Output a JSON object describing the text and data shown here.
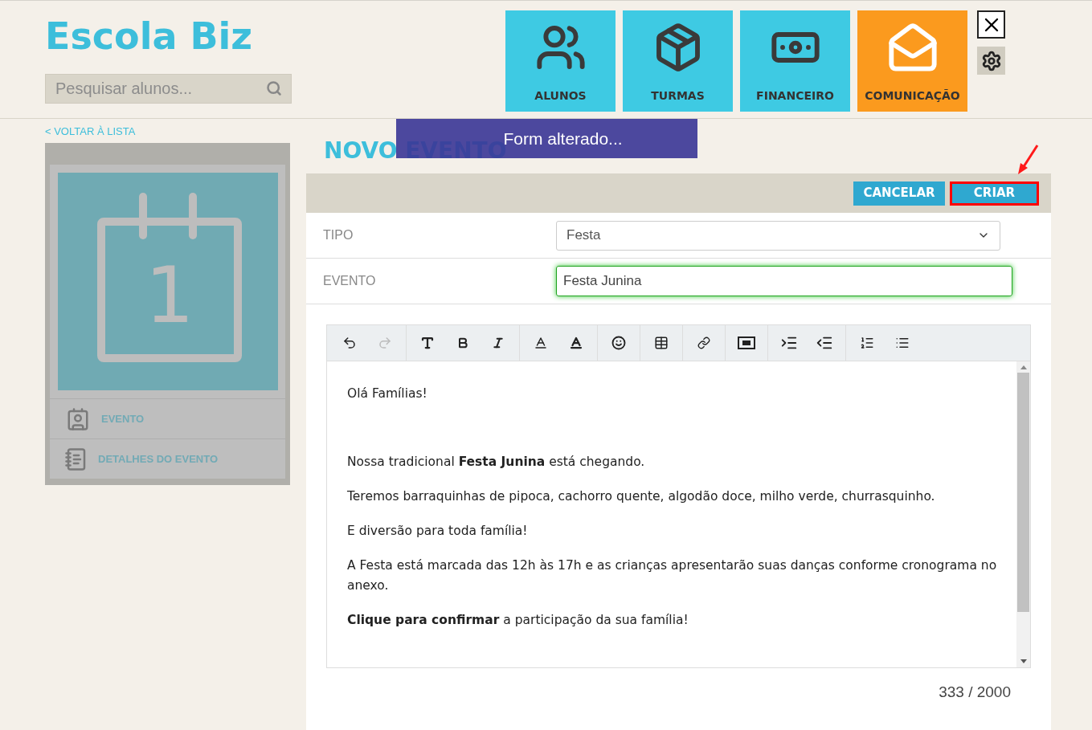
{
  "header": {
    "logo": "Escola Biz",
    "search": {
      "placeholder": "Pesquisar alunos..."
    },
    "nav": [
      {
        "label": "ALUNOS",
        "kind": "users",
        "selected": false
      },
      {
        "label": "TURMAS",
        "kind": "box",
        "selected": false
      },
      {
        "label": "FINANCEIRO",
        "kind": "money",
        "selected": false
      },
      {
        "label": "COMUNICAÇÃO",
        "kind": "mail",
        "selected": true
      }
    ]
  },
  "back_link": "< VOLTAR À LISTA",
  "sidebar": {
    "day": "1",
    "items": [
      {
        "label": "EVENTO",
        "kind": "contact"
      },
      {
        "label": "DETALHES DO EVENTO",
        "kind": "notebook"
      }
    ]
  },
  "heading": "NOVO EVENTO",
  "toast": "Form alterado...",
  "actions": [
    {
      "label": "CANCELAR",
      "highlighted": false
    },
    {
      "label": "CRIAR",
      "highlighted": true
    }
  ],
  "fields": [
    {
      "label": "TIPO",
      "kind": "select",
      "value": "Festa",
      "valid": false
    },
    {
      "label": "EVENTO",
      "kind": "text",
      "value": "Festa Junina",
      "valid": true
    }
  ],
  "editor": {
    "paragraphs": [
      "Olá Famílias!",
      "Nossa tradicional **Festa Junina** está chegando.",
      "Teremos barraquinhas de pipoca, cachorro quente, algodão doce, milho verde, churrasquinho.",
      "E diversão para toda família!",
      "A Festa está marcada das 12h às 17h e as crianças apresentarão suas danças conforme cronograma no anexo.",
      "**Clique para confirmar** a participação da sua família!"
    ],
    "counter": "333 / 2000"
  }
}
